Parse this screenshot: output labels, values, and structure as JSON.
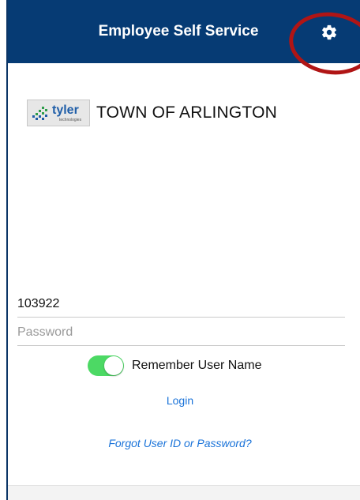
{
  "header": {
    "title": "Employee Self Service",
    "settings_icon": "gear-icon",
    "background_color": "#063b74"
  },
  "branding": {
    "logo_text": "tyler",
    "logo_subtext": "technologies",
    "organization_name": "TOWN OF ARLINGTON"
  },
  "login_form": {
    "username_value": "103922",
    "password_placeholder": "Password",
    "remember_label": "Remember User Name",
    "remember_enabled": true,
    "login_label": "Login",
    "forgot_label": "Forgot User ID or Password?"
  },
  "colors": {
    "link": "#1a73d9",
    "toggle_on": "#4cd964",
    "highlight": "#b01515"
  }
}
